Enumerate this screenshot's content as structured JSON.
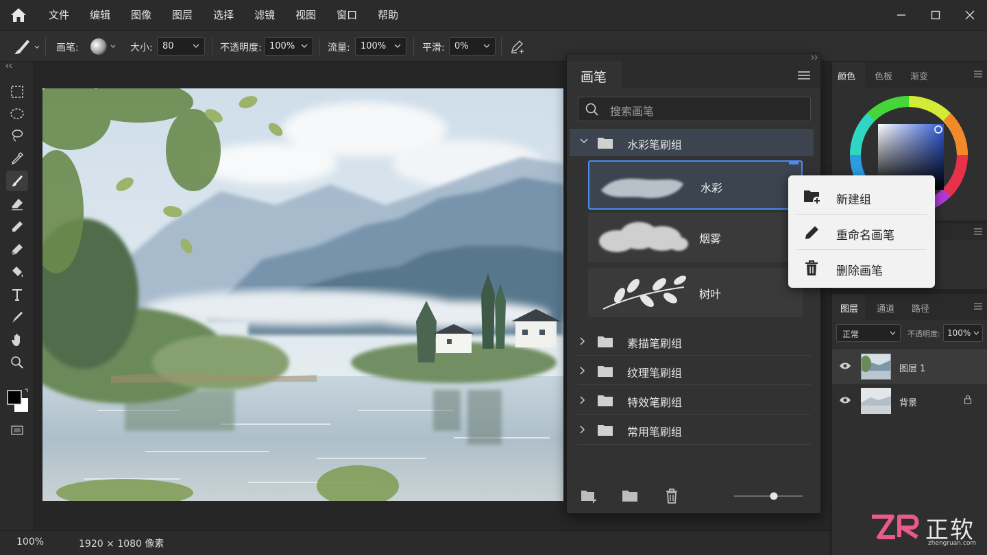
{
  "menubar": {
    "items": [
      "文件",
      "编辑",
      "图像",
      "图层",
      "选择",
      "滤镜",
      "视图",
      "窗口",
      "帮助"
    ]
  },
  "options": {
    "brush_label": "画笔:",
    "size_label": "大小:",
    "size_value": "80",
    "opacity_label": "不透明度:",
    "opacity_value": "100%",
    "flow_label": "流量:",
    "flow_value": "100%",
    "smoothing_label": "平滑:",
    "smoothing_value": "0%"
  },
  "status": {
    "zoom": "100%",
    "dimensions": "1920 × 1080 像素"
  },
  "brush_panel": {
    "title": "画笔",
    "search_placeholder": "搜索画笔",
    "expanded_group": "水彩笔刷组",
    "brushes": [
      "水彩",
      "烟雾",
      "树叶"
    ],
    "collapsed_groups": [
      "素描笔刷组",
      "纹理笔刷组",
      "特效笔刷组",
      "常用笔刷组"
    ],
    "size_slider": 0.58
  },
  "context_menu": {
    "items": [
      "新建组",
      "重命名画笔",
      "删除画笔"
    ]
  },
  "color_panel": {
    "tabs": [
      "颜色",
      "色板",
      "渐变"
    ],
    "current_color": "#2f5bd8"
  },
  "layers_panel": {
    "tabs": [
      "图层",
      "通道",
      "路径"
    ],
    "blend_mode": "正常",
    "opacity_label": "不透明度:",
    "opacity_value": "100%",
    "layers": [
      {
        "name": "图层 1"
      },
      {
        "name": "背景"
      }
    ]
  },
  "watermark": {
    "brand_cn": "正软",
    "brand_url": "zhengruan.com"
  }
}
